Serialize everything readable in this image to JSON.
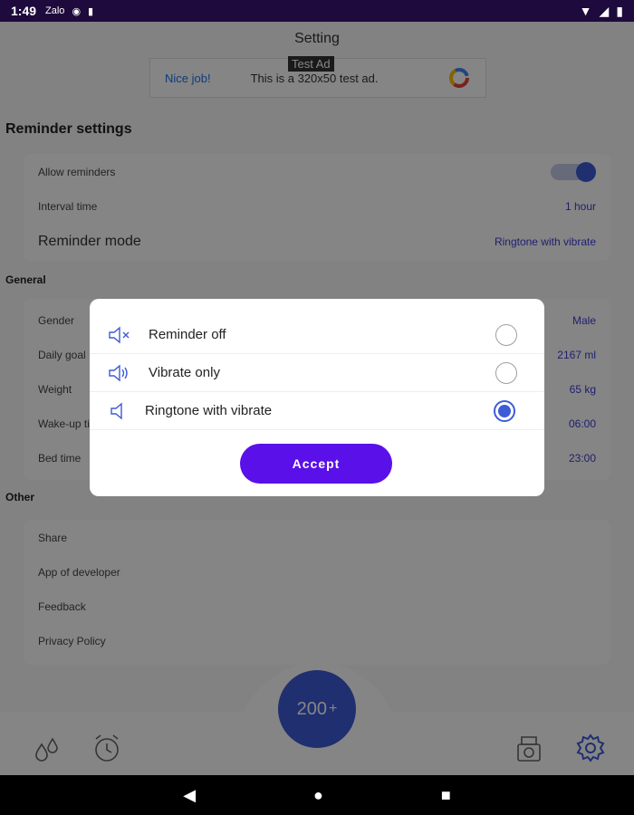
{
  "status_bar": {
    "time": "1:49",
    "carrier": "Zalo"
  },
  "header": {
    "title": "Setting"
  },
  "ad": {
    "label": "Test Ad",
    "nice": "Nice job!",
    "text": "This is a 320x50 test ad."
  },
  "reminder_section": {
    "title": "Reminder settings",
    "allow_reminders": "Allow reminders",
    "interval_label": "Interval time",
    "interval_value": "1 hour",
    "mode_label": "Reminder mode",
    "mode_value": "Ringtone with vibrate"
  },
  "general_section": {
    "title": "General",
    "items": [
      {
        "label": "Gender",
        "value": "Male"
      },
      {
        "label": "Daily goal",
        "value": "2167 ml"
      },
      {
        "label": "Weight",
        "value": "65 kg"
      },
      {
        "label": "Wake-up time",
        "value": "06:00"
      },
      {
        "label": "Bed time",
        "value": "23:00"
      }
    ]
  },
  "other_section": {
    "title": "Other",
    "items": [
      "Share",
      "App of developer",
      "Feedback",
      "Privacy Policy"
    ]
  },
  "bottom_nav": {
    "add_amount": "200",
    "add_plus": "+"
  },
  "dialog": {
    "options": [
      {
        "label": "Reminder off",
        "icon": "speaker-off-icon",
        "selected": false
      },
      {
        "label": "Vibrate only",
        "icon": "vibrate-icon",
        "selected": false
      },
      {
        "label": "Ringtone with vibrate",
        "icon": "speaker-icon",
        "selected": true
      }
    ],
    "accept": "Accept"
  },
  "colors": {
    "accent": "#3d5bd6",
    "accept_button": "#5a10e8",
    "status_bar": "#1e0a3c",
    "value_text": "#3d3dd6"
  }
}
